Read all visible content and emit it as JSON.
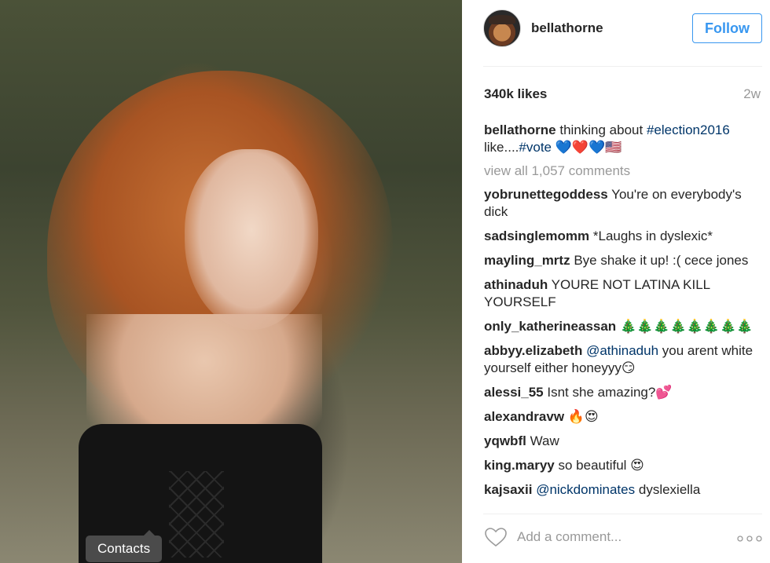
{
  "photo": {
    "tooltip": "Contacts"
  },
  "header": {
    "username": "bellathorne",
    "follow_label": "Follow"
  },
  "post": {
    "likes": "340k likes",
    "age": "2w",
    "caption": {
      "user": "bellathorne",
      "text_before": "thinking about ",
      "hashtag1": "#election2016",
      "text_middle": " like....",
      "hashtag2": "#vote",
      "emoji": " 💙❤️💙🇺🇸"
    },
    "view_all": "view all 1,057 comments"
  },
  "comments": [
    {
      "user": "yobrunettegoddess",
      "text": "You're on everybody's dick"
    },
    {
      "user": "sadsinglemomm",
      "text": "*Laughs in dyslexic*"
    },
    {
      "user": "mayling_mrtz",
      "text": "Bye shake it up! :( cece jones"
    },
    {
      "user": "athinaduh",
      "text": "YOURE NOT LATINA KILL YOURSELF"
    },
    {
      "user": "only_katherineassan",
      "text": "🎄🎄🎄🎄🎄🎄🎄🎄"
    },
    {
      "user": "abbyy.elizabeth",
      "mention": "@athinaduh",
      "text": "you arent white yourself either honeyyy😏"
    },
    {
      "user": "alessi_55",
      "text": "Isnt she amazing?💕"
    },
    {
      "user": "alexandravw",
      "text": "🔥😍"
    },
    {
      "user": "yqwbfl",
      "text": "Waw"
    },
    {
      "user": "king.maryy",
      "text": "so beautiful 😍"
    },
    {
      "user": "kajsaxii",
      "mention": "@nickdominates",
      "text": "dyslexiella"
    }
  ],
  "footer": {
    "comment_placeholder": "Add a comment..."
  },
  "icons": {
    "like": "heart-outline-icon",
    "more": "more-options-icon"
  },
  "colors": {
    "accent": "#3897f0",
    "link": "#003569",
    "muted": "#999999"
  }
}
